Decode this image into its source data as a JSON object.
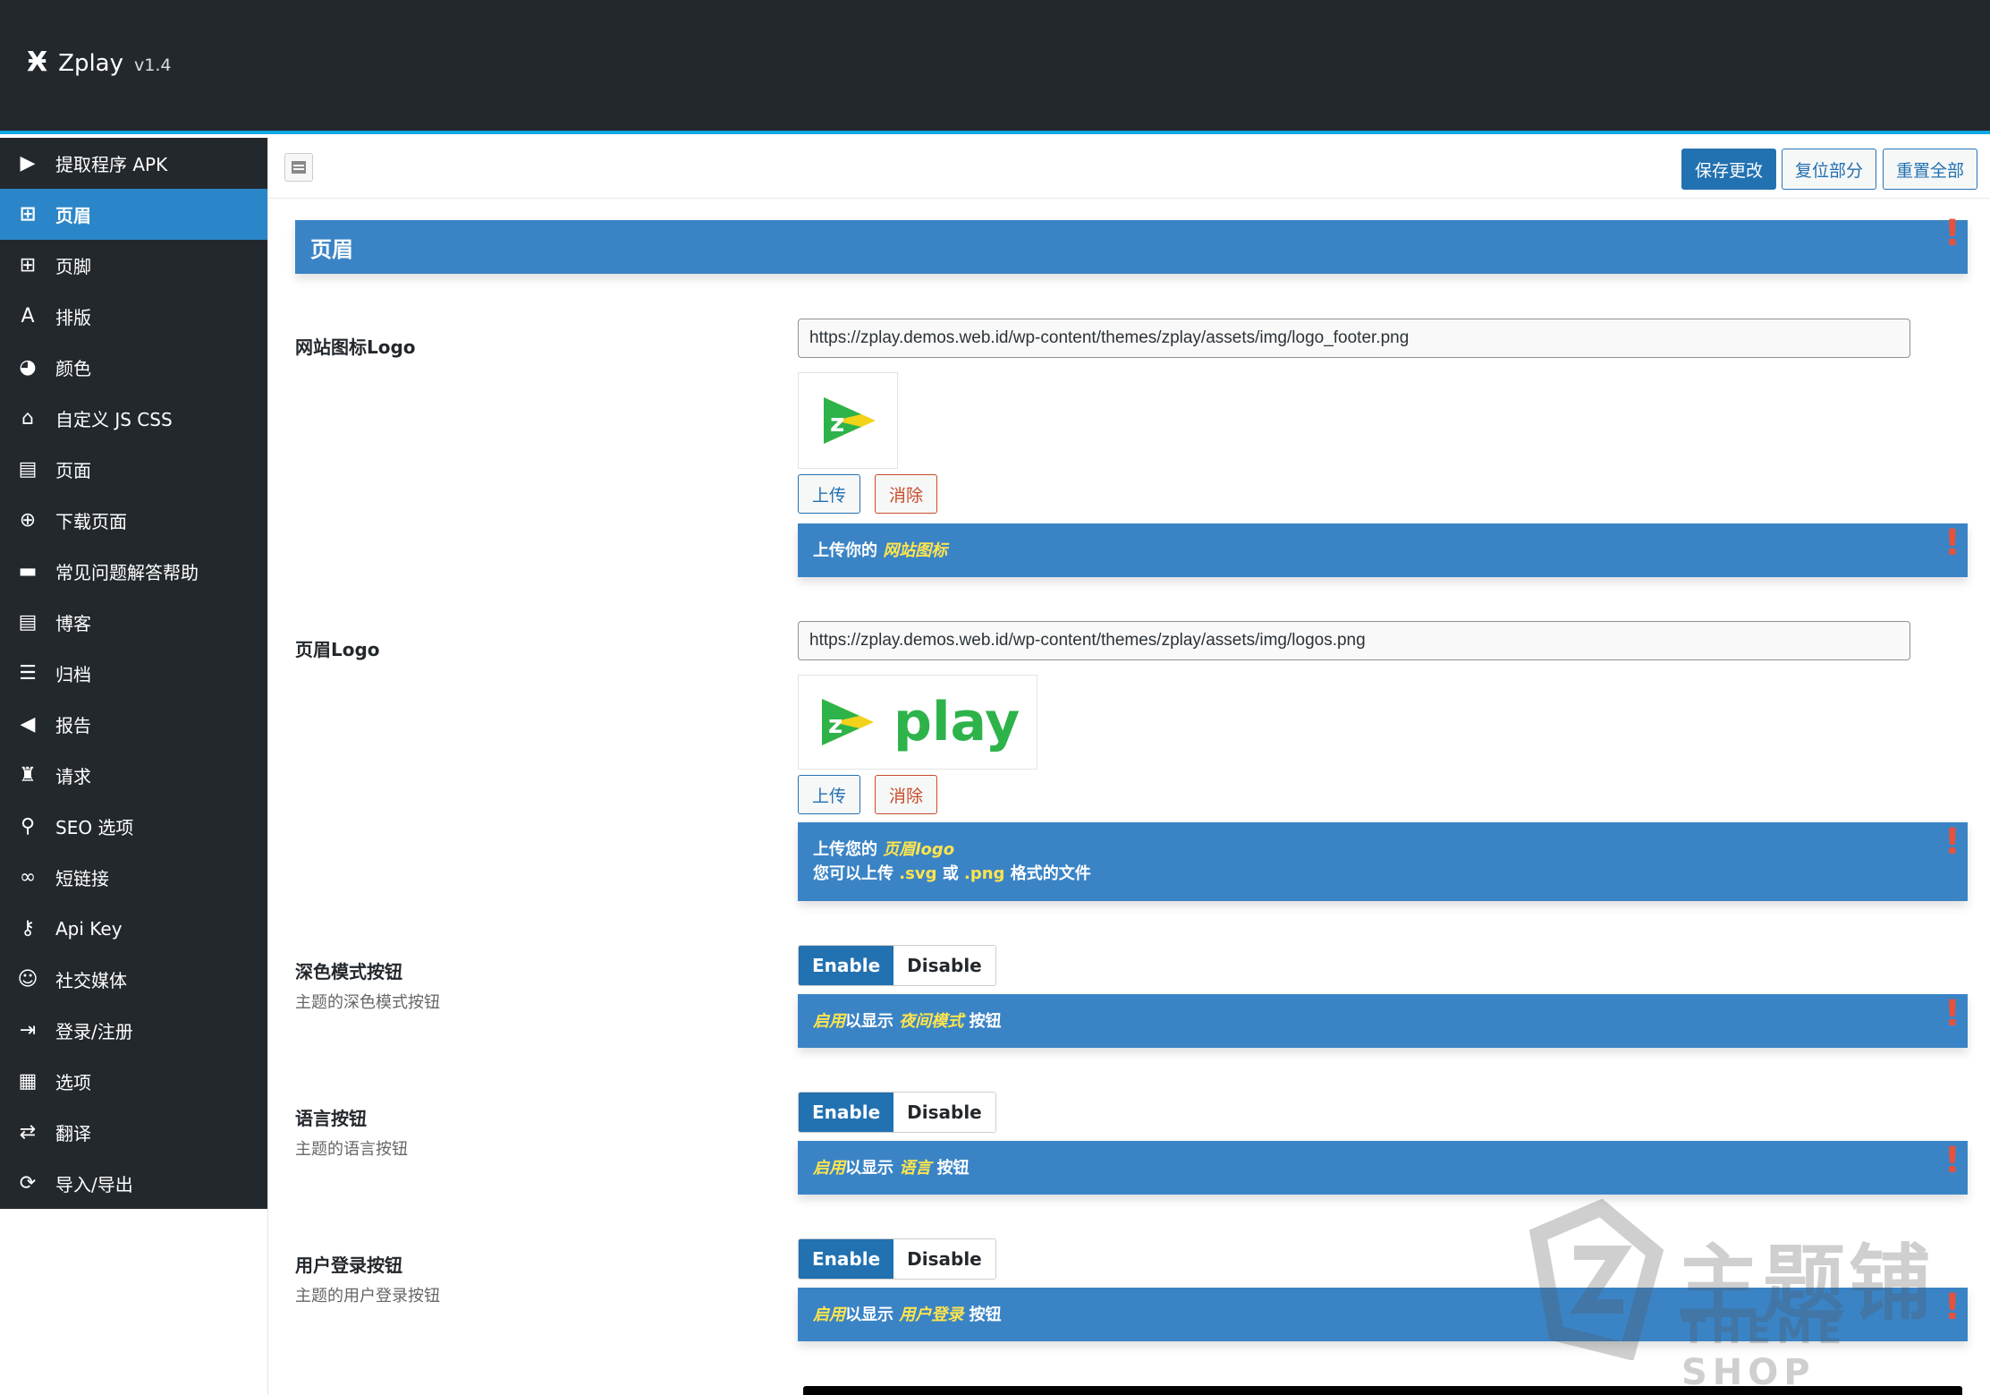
{
  "header": {
    "brand_mark": "Ӿ",
    "app_name": "Zplay",
    "version": "v1.4"
  },
  "sidebar": {
    "items": [
      {
        "icon": "play-icon",
        "glyph": "▶",
        "label": "提取程序 APK"
      },
      {
        "icon": "grid-icon",
        "glyph": "⊞",
        "label": "页眉"
      },
      {
        "icon": "grid-icon",
        "glyph": "⊞",
        "label": "页脚"
      },
      {
        "icon": "font-icon",
        "glyph": "A",
        "label": "排版"
      },
      {
        "icon": "palette-icon",
        "glyph": "◕",
        "label": "颜色"
      },
      {
        "icon": "code-icon",
        "glyph": "⌂",
        "label": "自定义 JS CSS"
      },
      {
        "icon": "clipboard-icon",
        "glyph": "▤",
        "label": "页面"
      },
      {
        "icon": "download-icon",
        "glyph": "⊕",
        "label": "下载页面"
      },
      {
        "icon": "comments-icon",
        "glyph": "▬",
        "label": "常见问题解答帮助"
      },
      {
        "icon": "clipboard-icon",
        "glyph": "▤",
        "label": "博客"
      },
      {
        "icon": "list-icon",
        "glyph": "☰",
        "label": "归档"
      },
      {
        "icon": "megaphone-icon",
        "glyph": "◀",
        "label": "报告"
      },
      {
        "icon": "request-icon",
        "glyph": "♜",
        "label": "请求"
      },
      {
        "icon": "search-icon",
        "glyph": "⚲",
        "label": "SEO 选项"
      },
      {
        "icon": "link-icon",
        "glyph": "∞",
        "label": "短链接"
      },
      {
        "icon": "key-icon",
        "glyph": "⚷",
        "label": "Api Key"
      },
      {
        "icon": "user-circle-icon",
        "glyph": "☺",
        "label": "社交媒体"
      },
      {
        "icon": "sign-in-icon",
        "glyph": "⇥",
        "label": "登录/注册"
      },
      {
        "icon": "options-icon",
        "glyph": "▦",
        "label": "选项"
      },
      {
        "icon": "translate-icon",
        "glyph": "⇄",
        "label": "翻译"
      },
      {
        "icon": "refresh-icon",
        "glyph": "⟳",
        "label": "导入/导出"
      }
    ],
    "active_label": "页眉"
  },
  "toolbar": {
    "save": "保存更改",
    "reset_section": "复位部分",
    "reset_all": "重置全部"
  },
  "section": {
    "title": "页眉"
  },
  "fields": {
    "site_logo": {
      "label": "网站图标Logo",
      "url": "https://zplay.demos.web.id/wp-content/themes/zplay/assets/img/logo_footer.png",
      "upload": "上传",
      "remove": "消除",
      "info_prefix": "上传你的",
      "info_highlight": "网站图标"
    },
    "header_logo": {
      "label": "页眉Logo",
      "url": "https://zplay.demos.web.id/wp-content/themes/zplay/assets/img/logos.png",
      "logo_text": "play",
      "upload": "上传",
      "remove": "消除",
      "info_prefix": "上传您的",
      "info_highlight": "页眉logo",
      "info2_a": "您可以上传",
      "info2_svg": ".svg",
      "info2_or": "或",
      "info2_png": ".png",
      "info2_b": "格式的文件"
    },
    "dark_mode": {
      "label": "深色模式按钮",
      "sub": "主题的深色模式按钮",
      "enable": "Enable",
      "disable": "Disable",
      "info_a": "启用",
      "info_b": "以显示",
      "info_highlight": "夜间模式",
      "info_c": "按钮"
    },
    "language": {
      "label": "语言按钮",
      "sub": "主题的语言按钮",
      "enable": "Enable",
      "disable": "Disable",
      "info_a": "启用",
      "info_b": "以显示",
      "info_highlight": "语言",
      "info_c": "按钮"
    },
    "user_login": {
      "label": "用户登录按钮",
      "sub": "主题的用户登录按钮",
      "enable": "Enable",
      "disable": "Disable",
      "info_a": "启用",
      "info_b": "以显示",
      "info_highlight": "用户登录",
      "info_c": "按钮"
    }
  },
  "watermark": {
    "cn": "主题铺",
    "en": "THEME SHOP"
  },
  "colors": {
    "accent": "#2271b1",
    "info_bg": "#3a84c6",
    "sidebar_bg": "#23282d",
    "highlight": "#ffe44d",
    "exclaim": "#e9523a"
  }
}
